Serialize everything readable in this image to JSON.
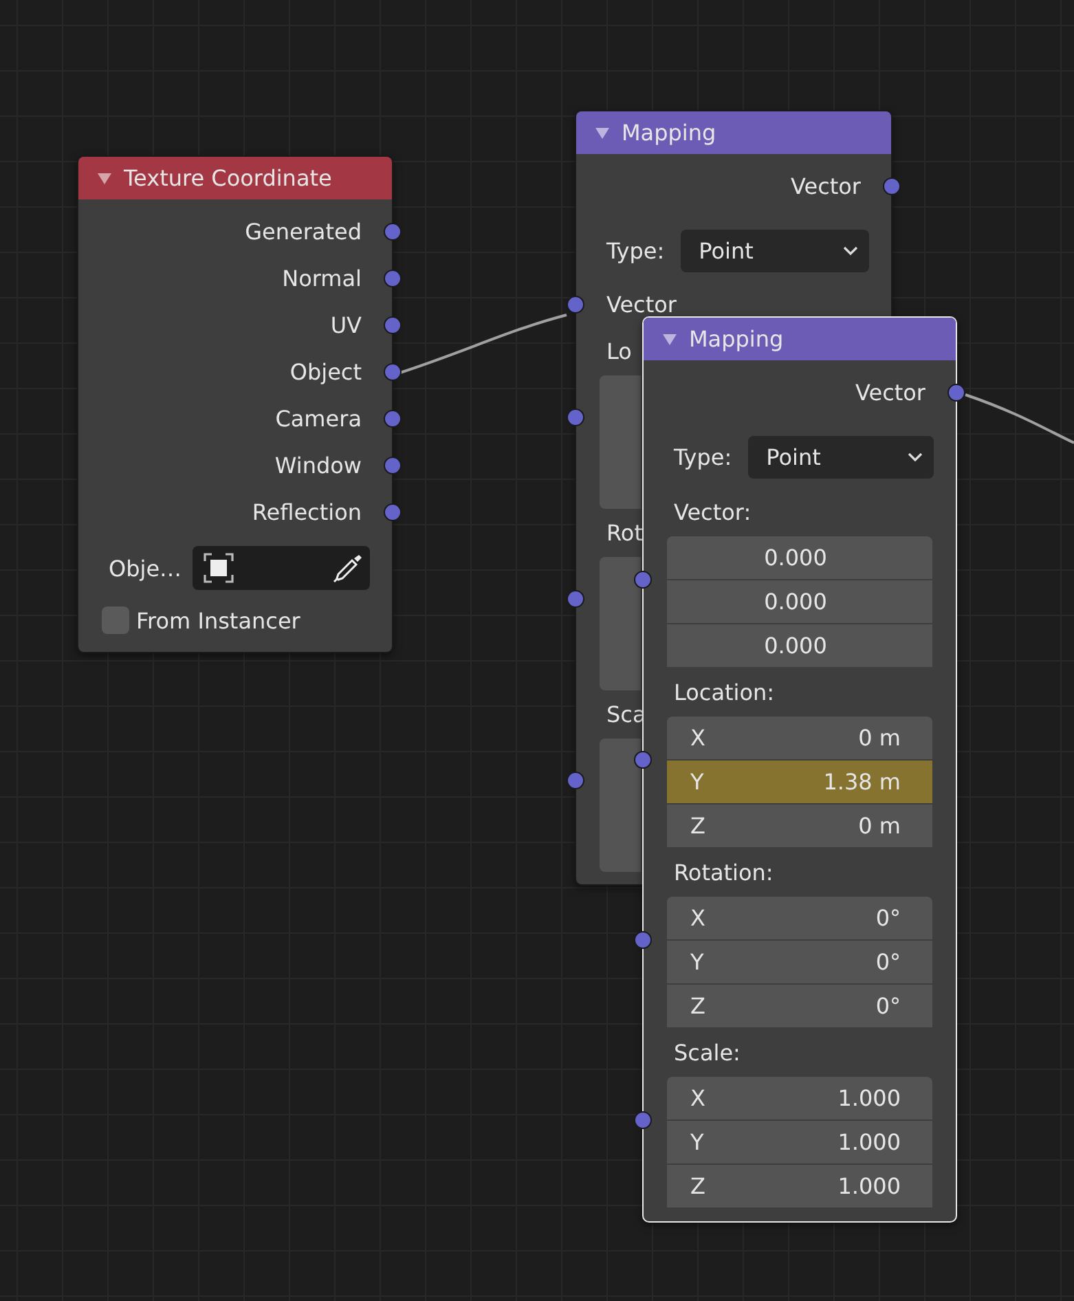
{
  "nodes": [
    {
      "kind": "texture_coordinate",
      "title": "Texture Coordinate",
      "selected": false,
      "outputs": [
        "Generated",
        "Normal",
        "UV",
        "Object",
        "Camera",
        "Window",
        "Reflection"
      ],
      "object_field": {
        "label": "Obje…"
      },
      "checkbox": {
        "label": "From Instancer",
        "checked": false
      }
    },
    {
      "kind": "mapping",
      "title": "Mapping",
      "selected": false,
      "output": "Vector",
      "type_label": "Type:",
      "type_value": "Point",
      "input": "Vector",
      "sections": [
        {
          "label": "Lo"
        },
        {
          "label": "Rot"
        },
        {
          "label": "Sca"
        }
      ]
    },
    {
      "kind": "mapping",
      "title": "Mapping",
      "selected": true,
      "output": "Vector",
      "type_label": "Type:",
      "type_value": "Point",
      "sections": [
        {
          "label": "Vector:",
          "fields": [
            {
              "value": "0.000",
              "keyframed": false
            },
            {
              "value": "0.000",
              "keyframed": false
            },
            {
              "value": "0.000",
              "keyframed": false
            }
          ]
        },
        {
          "label": "Location:",
          "fields": [
            {
              "axis": "X",
              "value": "0 m",
              "keyframed": false
            },
            {
              "axis": "Y",
              "value": "1.38 m",
              "keyframed": true
            },
            {
              "axis": "Z",
              "value": "0 m",
              "keyframed": false
            }
          ]
        },
        {
          "label": "Rotation:",
          "fields": [
            {
              "axis": "X",
              "value": "0°",
              "keyframed": false
            },
            {
              "axis": "Y",
              "value": "0°",
              "keyframed": false
            },
            {
              "axis": "Z",
              "value": "0°",
              "keyframed": false
            }
          ]
        },
        {
          "label": "Scale:",
          "fields": [
            {
              "axis": "X",
              "value": "1.000",
              "keyframed": false
            },
            {
              "axis": "Y",
              "value": "1.000",
              "keyframed": false
            },
            {
              "axis": "Z",
              "value": "1.000",
              "keyframed": false
            }
          ]
        }
      ]
    }
  ]
}
